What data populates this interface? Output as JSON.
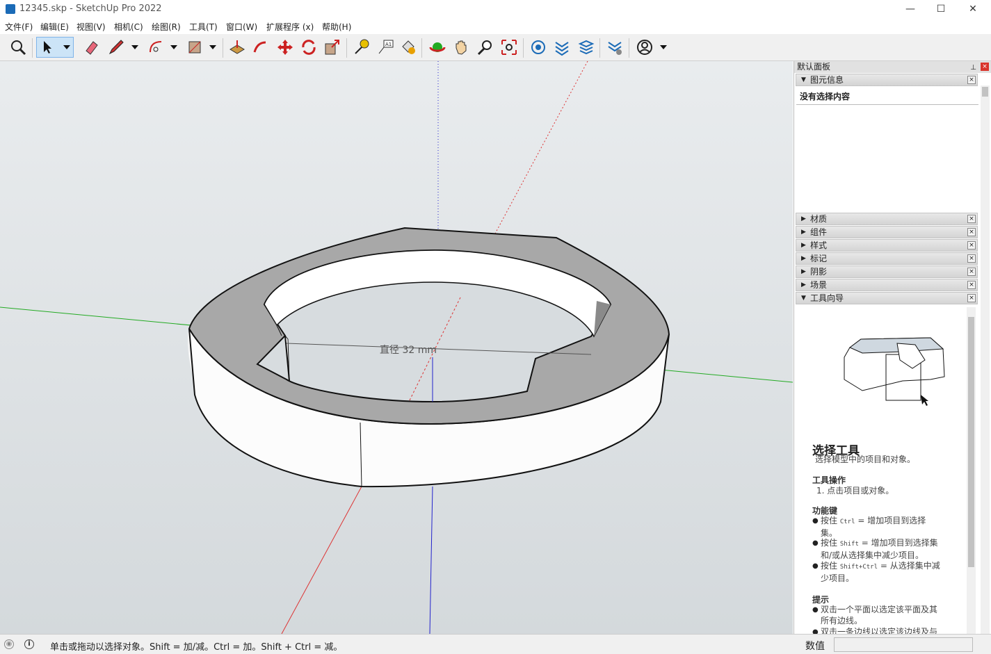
{
  "window": {
    "title": "12345.skp - SketchUp Pro 2022",
    "minimize": "—",
    "maximize": "☐",
    "close": "✕"
  },
  "menu": [
    "文件(F)",
    "编辑(E)",
    "视图(V)",
    "相机(C)",
    "绘图(R)",
    "工具(T)",
    "窗口(W)",
    "扩展程序 (x)",
    "帮助(H)"
  ],
  "viewport": {
    "dimension_label": "直径 32 mm"
  },
  "tray": {
    "title": "默认面板",
    "pin": "📌",
    "close": "×",
    "entity_info": {
      "label": "图元信息",
      "empty": "没有选择内容"
    },
    "panels": [
      "材质",
      "组件",
      "样式",
      "标记",
      "阴影",
      "场景",
      "工具向导"
    ],
    "instructor": {
      "title": "选择工具",
      "desc": "选择模型中的项目和对象。",
      "ops_heading": "工具操作",
      "ops_1": "1. 点击项目或对象。",
      "keys_heading": "功能键",
      "key1_a": "按住 ",
      "key1_code": "Ctrl",
      "key1_b": " = 增加项目到选择",
      "key1_c": "集。",
      "key2_a": "按住 ",
      "key2_code": "Shift",
      "key2_b": " = 增加项目到选择集",
      "key2_c": "和/或从选择集中减少项目。",
      "key3_a": "按住 ",
      "key3_code": "Shift+Ctrl",
      "key3_b": " = 从选择集中减",
      "key3_c": "少项目。",
      "tips_heading": "提示",
      "tip1_a": "双击一个平面以选定该平面及其",
      "tip1_b": "所有边线。",
      "tip2_a": "双击一条边线以选定该边线及与"
    }
  },
  "status": {
    "hint": "单击或拖动以选择对象。Shift = 加/减。Ctrl = 加。Shift + Ctrl = 减。",
    "measure_label": "数值",
    "measure_value": ""
  },
  "colors": {
    "axis_red": "#d33",
    "axis_green": "#2a2",
    "axis_blue": "#22c",
    "face_top": "#a8a8a8",
    "face_side": "#ffffff"
  }
}
